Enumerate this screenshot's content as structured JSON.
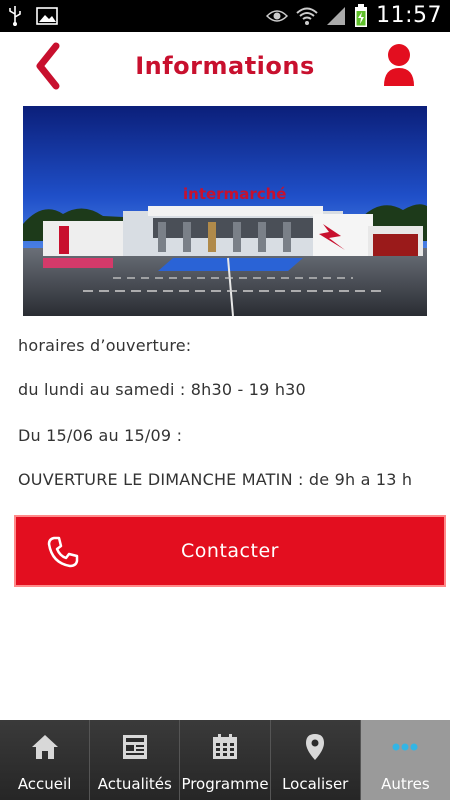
{
  "status_bar": {
    "time": "11:57",
    "icons": [
      "usb-icon",
      "image-icon",
      "eye-icon",
      "wifi-icon",
      "signal-icon",
      "battery-charging-icon"
    ]
  },
  "header": {
    "title": "Informations",
    "back_icon": "chevron-left-icon",
    "user_icon": "user-icon"
  },
  "colors": {
    "brand_red": "#c8102e",
    "button_red": "#e30e1f",
    "tab_bar": "#2b2b2b",
    "tab_active": "#9a9a9a",
    "active_icon": "#33b5e5"
  },
  "info": {
    "line1": "horaires d’ouverture:",
    "line2": "du lundi au samedi : 8h30 - 19 h30",
    "line3": "Du 15/06 au 15/09 :",
    "line4": "OUVERTURE LE DIMANCHE MATIN : de 9h a 13 h"
  },
  "contact": {
    "label": "Contacter",
    "icon": "phone-icon"
  },
  "store_photo": {
    "sign_text": "intermarché"
  },
  "tabs": [
    {
      "label": "Accueil",
      "icon": "home-icon",
      "active": false
    },
    {
      "label": "Actualités",
      "icon": "newspaper-icon",
      "active": false
    },
    {
      "label": "Programme",
      "icon": "calendar-icon",
      "active": false
    },
    {
      "label": "Localiser",
      "icon": "map-pin-icon",
      "active": false
    },
    {
      "label": "Autres",
      "icon": "more-icon",
      "active": true
    }
  ]
}
